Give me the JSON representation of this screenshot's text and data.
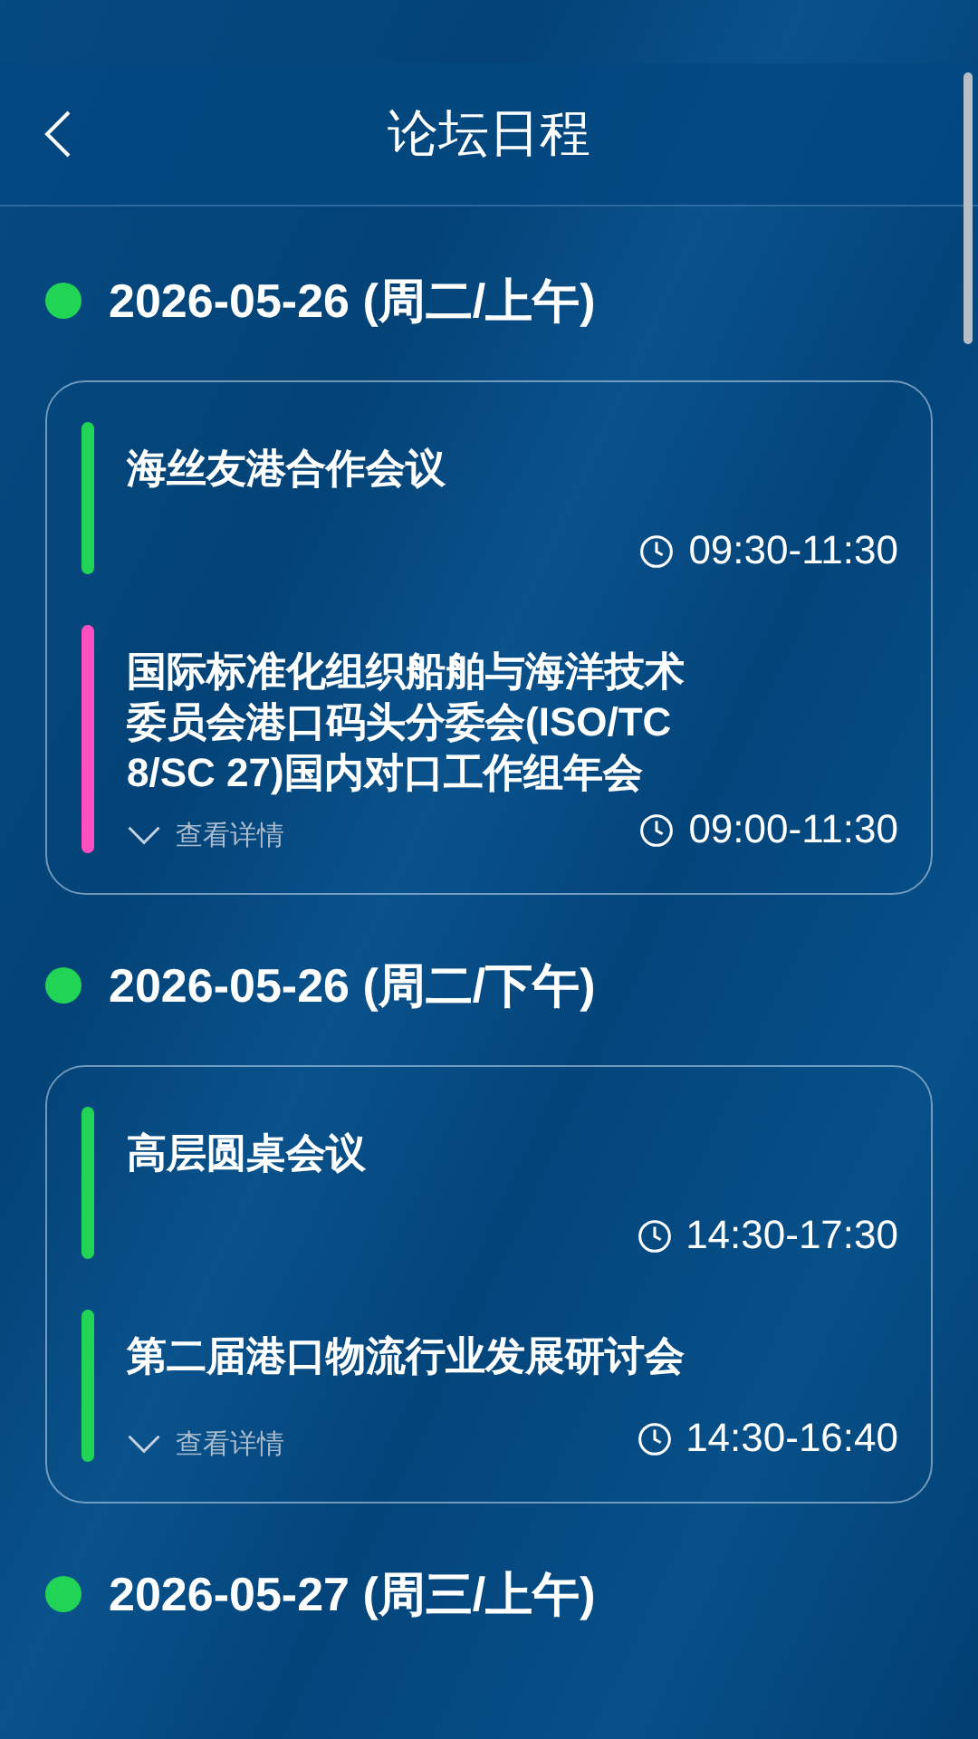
{
  "header": {
    "title": "论坛日程"
  },
  "days": [
    {
      "date": "2026-05-26 (周二/上午)",
      "color": "#22d455",
      "sessions": [
        {
          "title": "海丝友港合作会议",
          "time": "09:30-11:30",
          "color": "#22d455"
        },
        {
          "title": "国际标准化组织船舶与海洋技术委员会港口码头分委会(ISO/TC 8/SC 27)国内对口工作组年会",
          "time": "09:00-11:30",
          "color": "#ff4fc0",
          "details_label": "查看详情"
        }
      ]
    },
    {
      "date": "2026-05-26 (周二/下午)",
      "color": "#22d455",
      "sessions": [
        {
          "title": "高层圆桌会议",
          "time": "14:30-17:30",
          "color": "#22d455"
        },
        {
          "title": "第二届港口物流行业发展研讨会",
          "time": "14:30-16:40",
          "color": "#22d455",
          "details_label": "查看详情"
        }
      ]
    },
    {
      "date": "2026-05-27 (周三/上午)",
      "color": "#22d455"
    }
  ]
}
